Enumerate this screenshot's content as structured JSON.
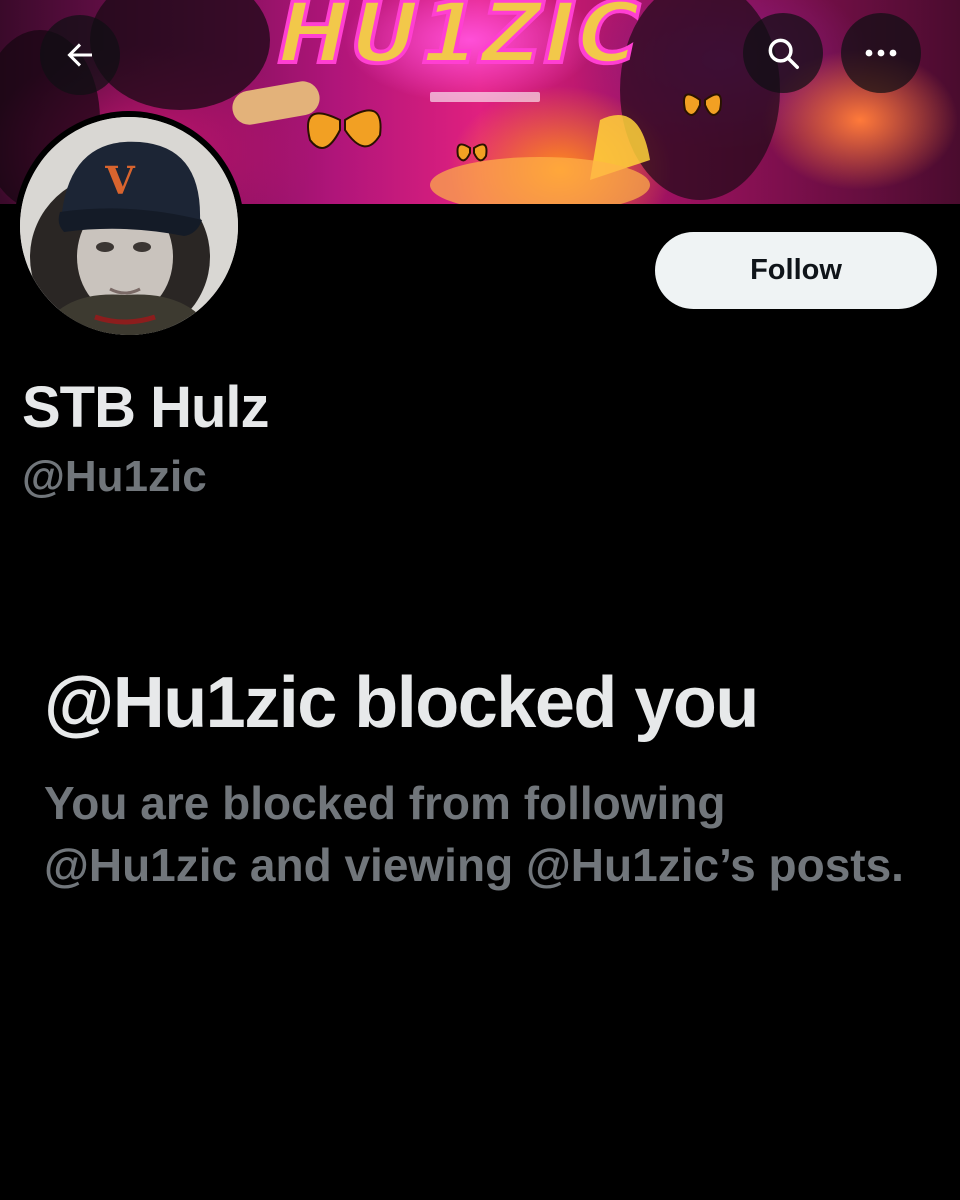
{
  "header": {
    "back_icon": "arrow-left-icon",
    "search_icon": "search-icon",
    "more_icon": "more-horizontal-icon",
    "banner_text": "HU1ZIC"
  },
  "profile": {
    "display_name": "STB Hulz",
    "handle": "@Hu1zic",
    "avatar_cap_letter": "V",
    "follow_label": "Follow"
  },
  "blocked": {
    "title": "@Hu1zic blocked you",
    "description": "You are blocked from following @Hu1zic and viewing @Hu1zic’s posts."
  },
  "colors": {
    "background": "#000000",
    "primary_text": "#e7e9ea",
    "secondary_text": "#71767b",
    "follow_button_bg": "#eff3f4",
    "follow_button_text": "#0f1419"
  }
}
